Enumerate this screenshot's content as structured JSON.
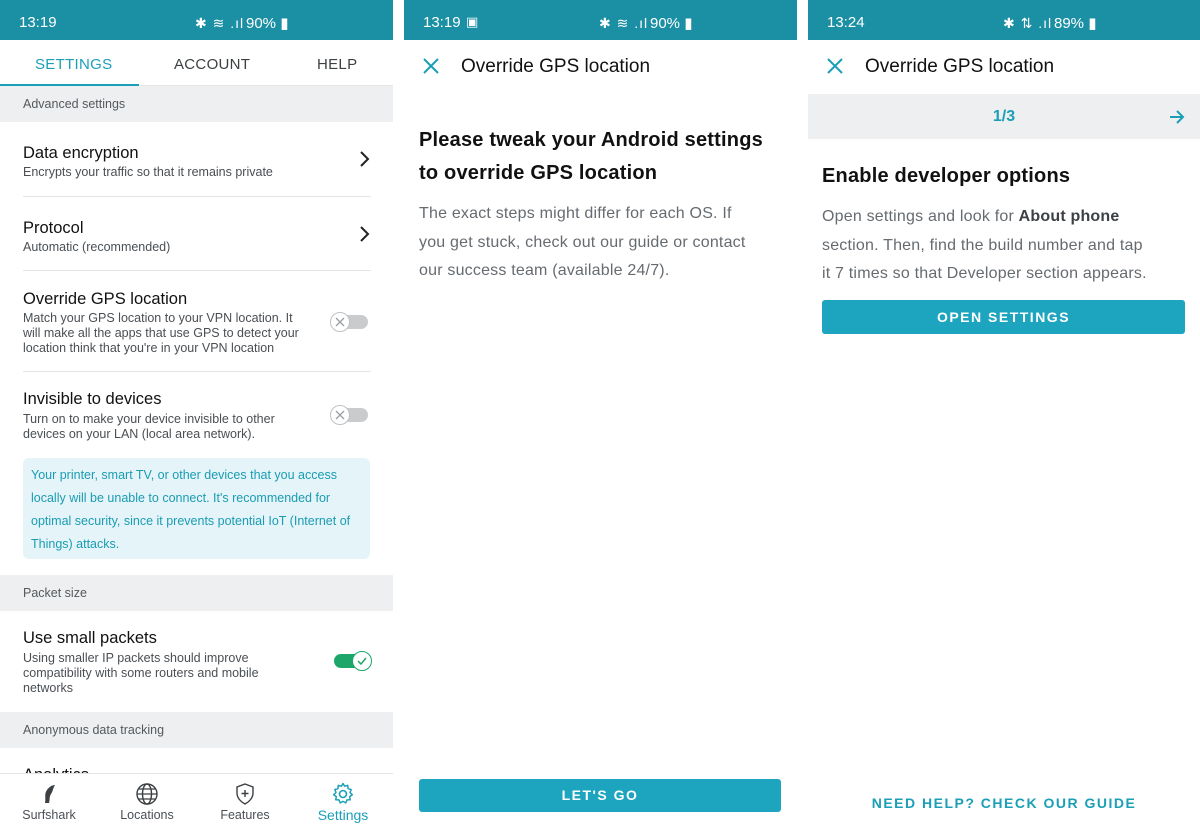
{
  "panels": {
    "settings": {
      "status": {
        "time": "13:19",
        "signal": "✱ ≋ .ıl",
        "battery": "90% ▮"
      },
      "tabs": [
        {
          "label": "SETTINGS",
          "active": true
        },
        {
          "label": "ACCOUNT",
          "active": false
        },
        {
          "label": "HELP",
          "active": false
        }
      ],
      "sections": {
        "advanced": "Advanced settings",
        "packet": "Packet size",
        "tracking": "Anonymous data tracking"
      },
      "rows": {
        "encryption": {
          "title": "Data encryption",
          "subtitle": "Encrypts your traffic so that it remains private"
        },
        "protocol": {
          "title": "Protocol",
          "subtitle": "Automatic (recommended)"
        },
        "gps": {
          "title": "Override GPS location",
          "line1": "Match your GPS location to your VPN location. It",
          "line2": "will make all the apps that use GPS to detect your",
          "line3": "location think that you're in your VPN location",
          "toggle_on": false
        },
        "invisible": {
          "title": "Invisible to devices",
          "line1": "Turn on to make your device invisible to other",
          "line2": "devices on your LAN (local area network).",
          "toggle_on": false
        },
        "small_packets": {
          "title": "Use small packets",
          "line1": "Using smaller IP packets should improve",
          "line2": "compatibility with some routers and mobile",
          "line3": "networks",
          "toggle_on": true
        },
        "analytics": {
          "title": "Analytics"
        }
      },
      "info_box": {
        "line1": "Your printer, smart TV, or other devices that you access",
        "line2": "locally will be unable to connect. It's recommended for",
        "line3": "optimal security, since it prevents potential IoT (Internet of",
        "line4": "Things) attacks."
      },
      "nav": [
        {
          "label": "Surfshark",
          "icon": "surfshark-logo-icon"
        },
        {
          "label": "Locations",
          "icon": "globe-icon"
        },
        {
          "label": "Features",
          "icon": "shield-plus-icon"
        },
        {
          "label": "Settings",
          "icon": "gear-icon",
          "active": true
        }
      ]
    },
    "override_intro": {
      "status": {
        "time": "13:19",
        "extra": "▣",
        "signal": "✱ ≋ .ıl",
        "battery": "90% ▮"
      },
      "title": "Override GPS location",
      "headline_line1": "Please tweak your Android settings",
      "headline_line2": "to override GPS location",
      "body_line1": "The exact steps might differ for each OS. If",
      "body_line2": "you get stuck, check out our guide or contact",
      "body_line3": "our success team (available 24/7).",
      "button": "LET'S GO"
    },
    "override_step": {
      "status": {
        "time": "13:24",
        "signal": "✱ ⇅ .ıl",
        "battery": "89% ▮"
      },
      "title": "Override GPS location",
      "step": "1/3",
      "step_title": "Enable developer options",
      "body_pre": "Open settings and look for ",
      "body_bold": "About phone",
      "body_line2": "section. Then, find the build number and tap",
      "body_line3": "it 7 times so that Developer section appears.",
      "button": "OPEN SETTINGS",
      "help_link": "NEED HELP? CHECK OUR GUIDE"
    }
  },
  "colors": {
    "statusbar": "#1b8fa3",
    "accent": "#1a9fb6",
    "toggle_on": "#1ca66a",
    "info_bg": "#e5f4f8"
  }
}
